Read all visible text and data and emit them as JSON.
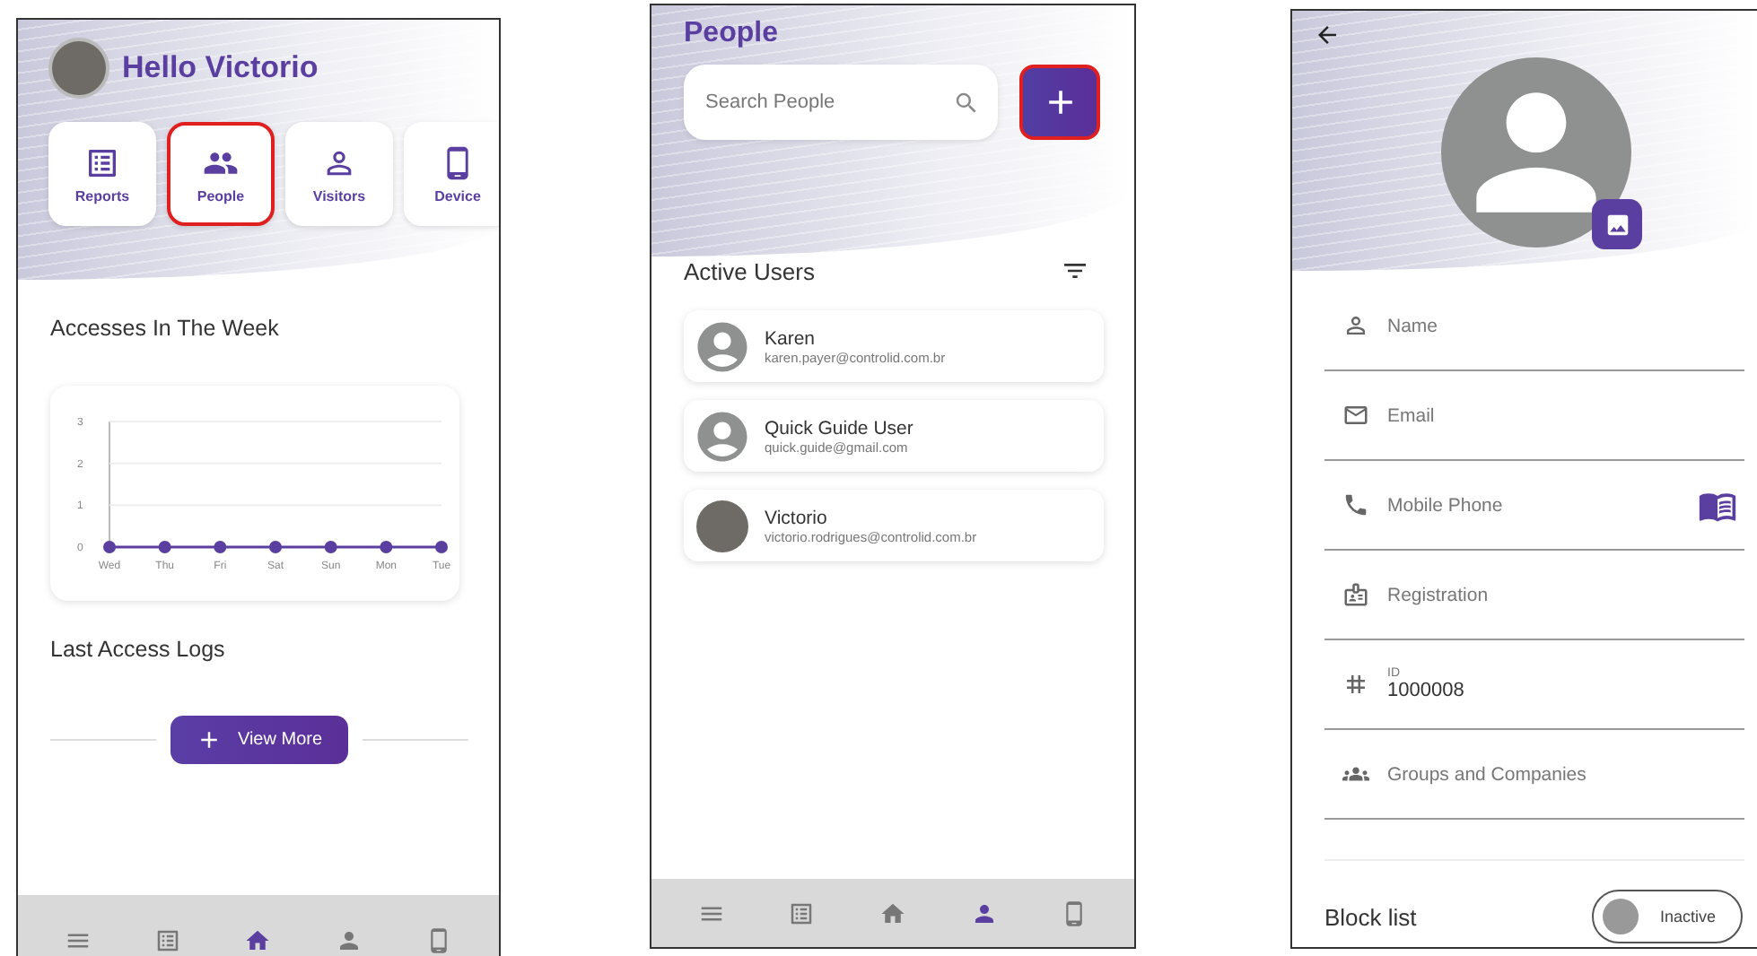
{
  "screens": [
    {
      "kind": "home",
      "greeting": "Hello Victorio",
      "shortcuts": [
        {
          "label": "Reports",
          "highlighted": false
        },
        {
          "label": "People",
          "highlighted": true
        },
        {
          "label": "Visitors",
          "highlighted": false
        },
        {
          "label": "Device",
          "highlighted": false
        }
      ],
      "chart_title": "Accesses In The Week",
      "chart_data": {
        "type": "line",
        "categories": [
          "Wed",
          "Thu",
          "Fri",
          "Sat",
          "Sun",
          "Mon",
          "Tue"
        ],
        "series": [
          {
            "color": "#5b3fa0",
            "marker": true,
            "values": [
              0,
              0,
              0,
              0,
              0,
              0,
              0
            ]
          }
        ],
        "ylim": [
          0,
          3
        ],
        "yticks": [
          0,
          1,
          2,
          3
        ]
      },
      "logs_title": "Last Access Logs",
      "view_more": "View More",
      "nav": [
        {
          "selected": false
        },
        {
          "selected": false
        },
        {
          "selected": true
        },
        {
          "selected": false
        },
        {
          "selected": false
        }
      ]
    },
    {
      "kind": "people",
      "title": "People",
      "search": {
        "placeholder": "Search People"
      },
      "add_button": {
        "highlighted": true
      },
      "list_title": "Active Users",
      "users": [
        {
          "name": "Karen",
          "email": "karen.payer@controlid.com.br",
          "photo": false
        },
        {
          "name": "Quick Guide User",
          "email": "quick.guide@gmail.com",
          "photo": false
        },
        {
          "name": "Victorio",
          "email": "victorio.rodrigues@controlid.com.br",
          "photo": true
        }
      ],
      "nav": [
        {
          "selected": false
        },
        {
          "selected": false
        },
        {
          "selected": false
        },
        {
          "selected": true
        },
        {
          "selected": false
        }
      ]
    },
    {
      "kind": "form",
      "fields": [
        {
          "kind": "input",
          "placeholder": "Name"
        },
        {
          "kind": "input",
          "placeholder": "Email"
        },
        {
          "kind": "contact",
          "placeholder": "Mobile Phone"
        },
        {
          "kind": "input",
          "placeholder": "Registration"
        },
        {
          "kind": "filled",
          "label": "ID",
          "value": "1000008"
        },
        {
          "kind": "input",
          "placeholder": "Groups and Companies"
        }
      ],
      "block_list": {
        "label": "Block list",
        "toggle": "Inactive",
        "on": false
      }
    }
  ]
}
